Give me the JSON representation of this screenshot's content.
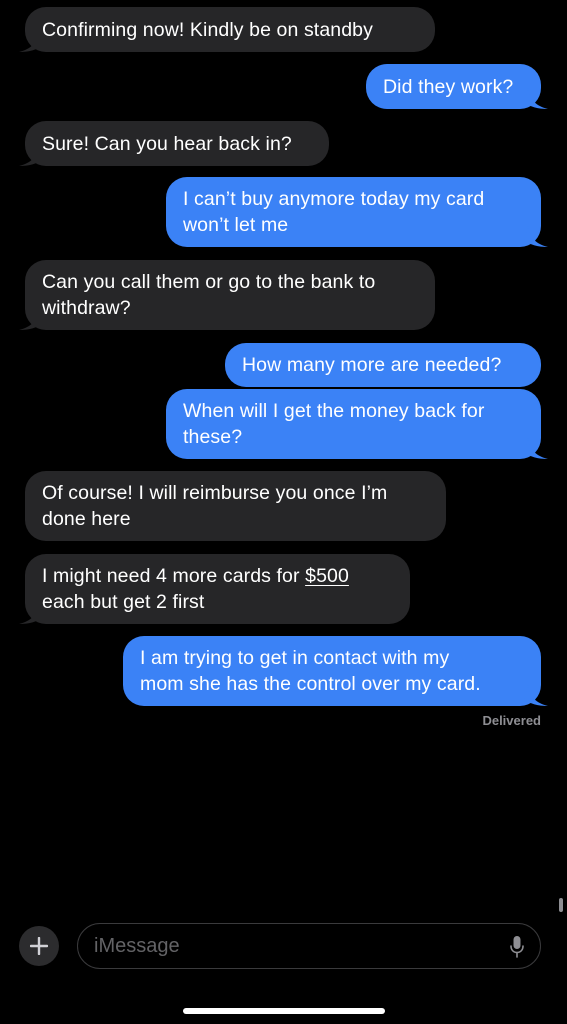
{
  "colors": {
    "incoming_bubble": "#262628",
    "outgoing_bubble": "#3b82f6",
    "background": "#000000",
    "secondary_text": "#8e8e93"
  },
  "messages": [
    {
      "direction": "incoming",
      "lines": [
        "Confirming now! Kindly be on standby"
      ]
    },
    {
      "direction": "outgoing",
      "lines": [
        "Did they work?"
      ]
    },
    {
      "direction": "incoming",
      "lines": [
        "Sure! Can you hear back in?"
      ]
    },
    {
      "direction": "outgoing",
      "lines": [
        "I can’t buy anymore today my card",
        "won’t let me"
      ]
    },
    {
      "direction": "incoming",
      "lines": [
        "Can you call them or go to the bank to",
        "withdraw?"
      ]
    },
    {
      "direction": "outgoing",
      "lines": [
        "How many more are needed?"
      ]
    },
    {
      "direction": "outgoing",
      "lines": [
        "When will I get the money back for",
        "these?"
      ]
    },
    {
      "direction": "incoming",
      "lines": [
        "Of course! I will reimburse you once I’m",
        "done here"
      ]
    },
    {
      "direction": "incoming",
      "line1_prefix": "I might need 4 more cards for ",
      "line1_link": "$500",
      "lines": [
        "each but get 2 first"
      ]
    },
    {
      "direction": "outgoing",
      "lines": [
        "I am trying to get in contact with my",
        "mom she has the control over my card."
      ]
    }
  ],
  "status": "Delivered",
  "composer": {
    "plus_icon": "plus-icon",
    "placeholder": "iMessage",
    "mic_icon": "microphone-icon"
  }
}
